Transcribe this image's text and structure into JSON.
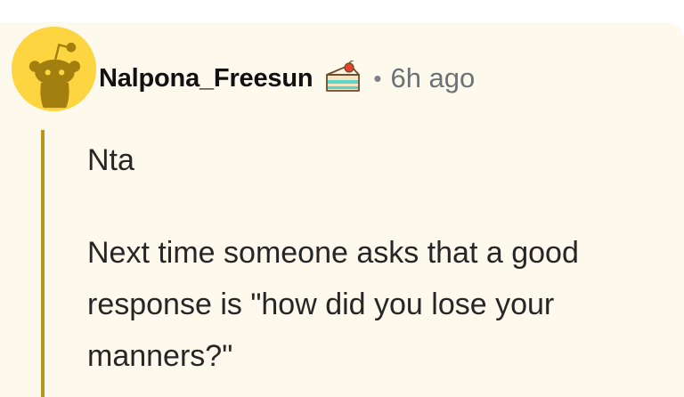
{
  "comment": {
    "author": "Nalpona_Freesun",
    "separator": "•",
    "time_ago": "6h ago",
    "avatar_icon": "reddit-snoo-avatar-icon",
    "flair_icon": "cake-icon",
    "paragraphs": [
      "Nta",
      "Next time someone asks that a good response is \"how did you lose your manners?\""
    ]
  },
  "colors": {
    "card_background": "#fdf9ec",
    "avatar_background": "#fcd540",
    "thread_line": "#b8961d",
    "author_text": "#111111",
    "meta_text": "#6b7277",
    "body_text": "#262626"
  }
}
